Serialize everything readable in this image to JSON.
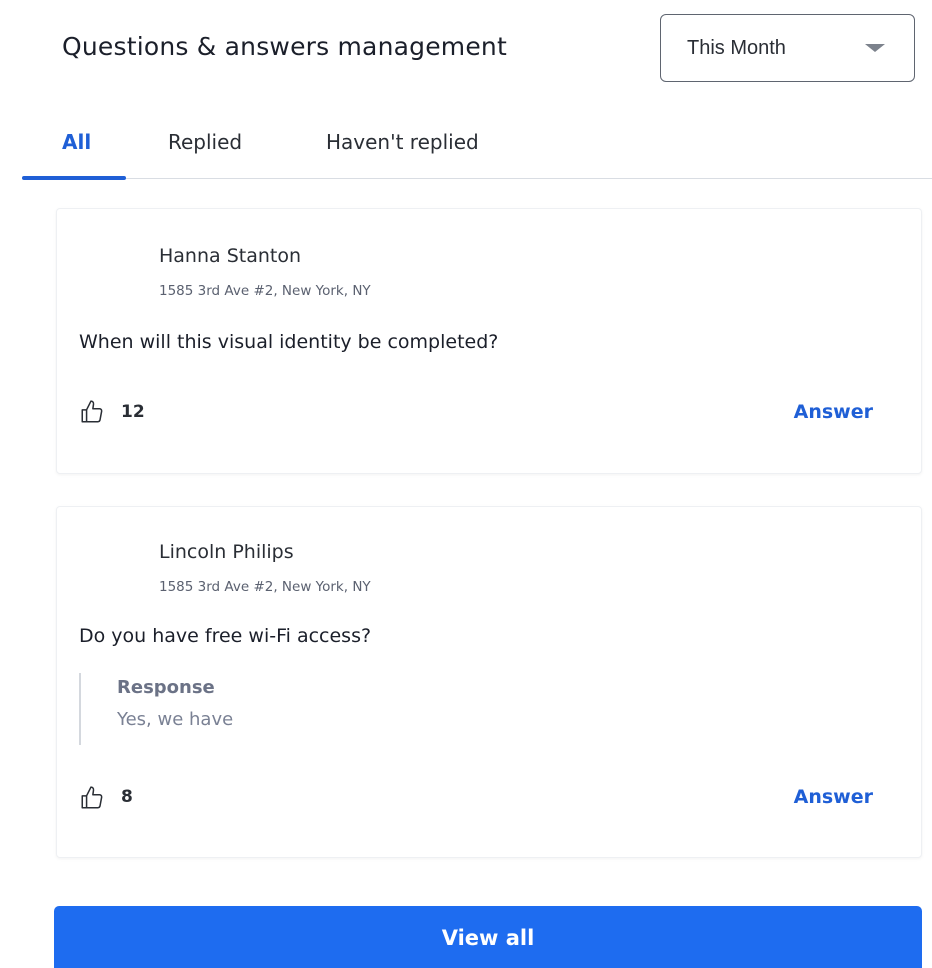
{
  "header": {
    "title": "Questions & answers management",
    "period_select": {
      "selected": "This Month"
    }
  },
  "tabs": [
    {
      "label": "All",
      "active": true
    },
    {
      "label": "Replied",
      "active": false
    },
    {
      "label": "Haven't replied",
      "active": false
    }
  ],
  "questions": [
    {
      "author": "Hanna Stanton",
      "address": "1585 3rd Ave #2, New York, NY",
      "question": "When will this visual identity be completed?",
      "likes": "12",
      "answer_label": "Answer"
    },
    {
      "author": "Lincoln Philips",
      "address": "1585 3rd Ave #2, New York, NY",
      "question": "Do you have free  wi-Fi access?",
      "response": {
        "label": "Response",
        "text": "Yes, we have"
      },
      "likes": "8",
      "answer_label": "Answer"
    }
  ],
  "view_all_label": "View all",
  "icons": {
    "like": "thumbs-up-outline-icon",
    "dropdown": "caret-down-icon"
  },
  "colors": {
    "accent": "#1f5fd6",
    "button": "#1e6cf0"
  }
}
